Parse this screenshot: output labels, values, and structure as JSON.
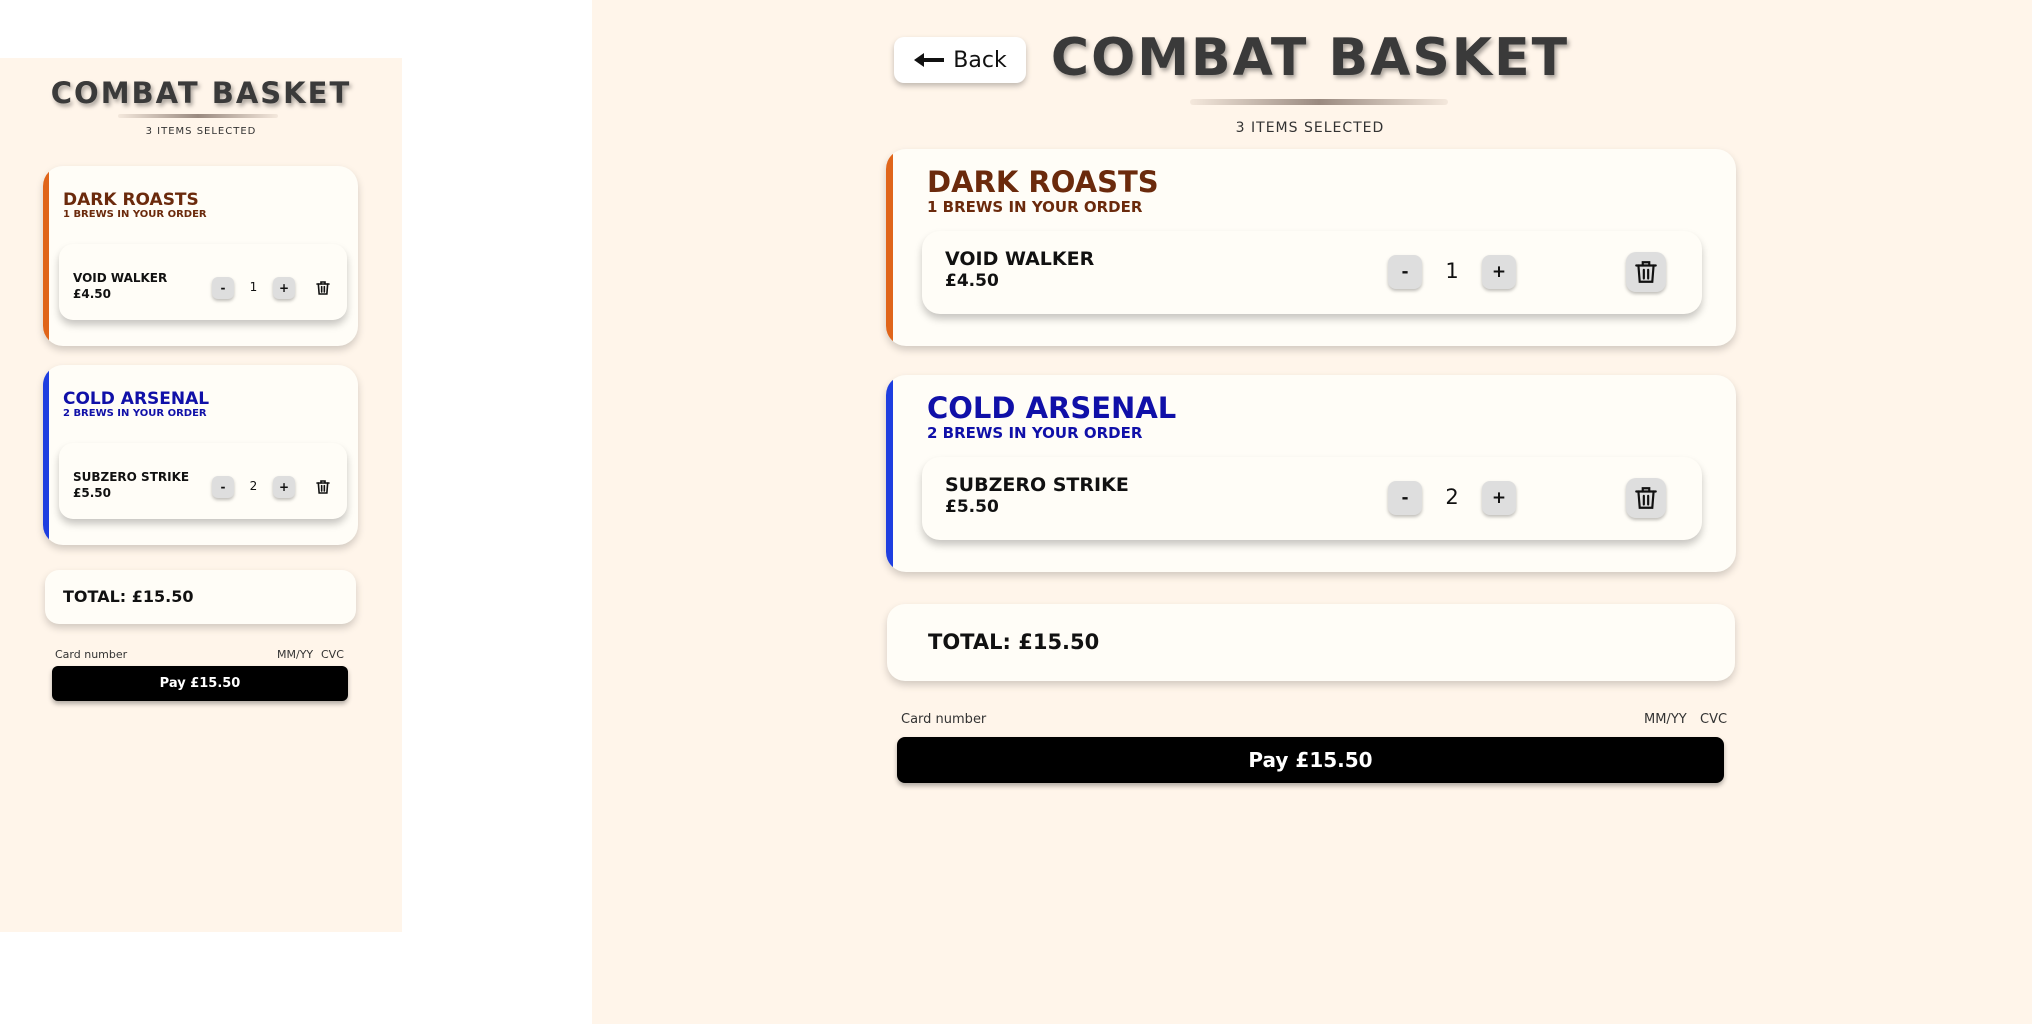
{
  "back_button": {
    "label": "Back"
  },
  "basket": {
    "title": "COMBAT BASKET",
    "items_selected": "3 ITEMS SELECTED",
    "categories": [
      {
        "name": "DARK ROASTS",
        "count_text": "1 BREWS IN YOUR ORDER",
        "color": "#6b2a0c",
        "accent": "#e0651a",
        "items": [
          {
            "name": "VOID WALKER",
            "price": "£4.50",
            "qty": "1"
          }
        ]
      },
      {
        "name": "COLD ARSENAL",
        "count_text": "2 BREWS IN YOUR ORDER",
        "color": "#1010a8",
        "accent": "#1e3ee0",
        "items": [
          {
            "name": "SUBZERO STRIKE",
            "price": "£5.50",
            "qty": "2"
          }
        ]
      }
    ],
    "minus_label": "-",
    "plus_label": "+",
    "total": "TOTAL: £15.50",
    "payment": {
      "card_number_label": "Card number",
      "expiry_label": "MM/YY",
      "cvc_label": "CVC",
      "pay_label": "Pay £15.50"
    }
  },
  "icons": {
    "back": "arrow-left-icon",
    "delete": "trash-icon"
  },
  "colors": {
    "page_bg": "#fff5ea",
    "card_bg": "#fffdf7",
    "pay_bg": "#000000"
  }
}
